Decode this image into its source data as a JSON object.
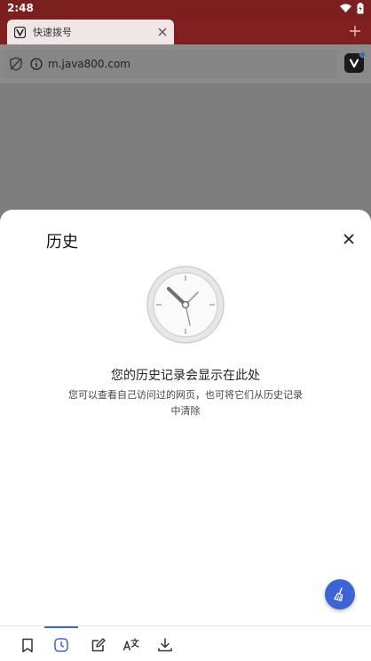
{
  "status": {
    "time": "2:48"
  },
  "tab": {
    "title": "快速拨号"
  },
  "address": {
    "url": "m.java800.com"
  },
  "sheet": {
    "title": "历史",
    "empty_heading": "您的历史记录会显示在此处",
    "empty_desc": "您可以查看自己访问过的网页，也可将它们从历史记录中清除"
  },
  "colors": {
    "brand": "#801f20",
    "accent": "#3c64d6"
  },
  "nav": [
    "bookmark-icon",
    "history-icon",
    "notes-icon",
    "translate-icon",
    "download-icon"
  ]
}
